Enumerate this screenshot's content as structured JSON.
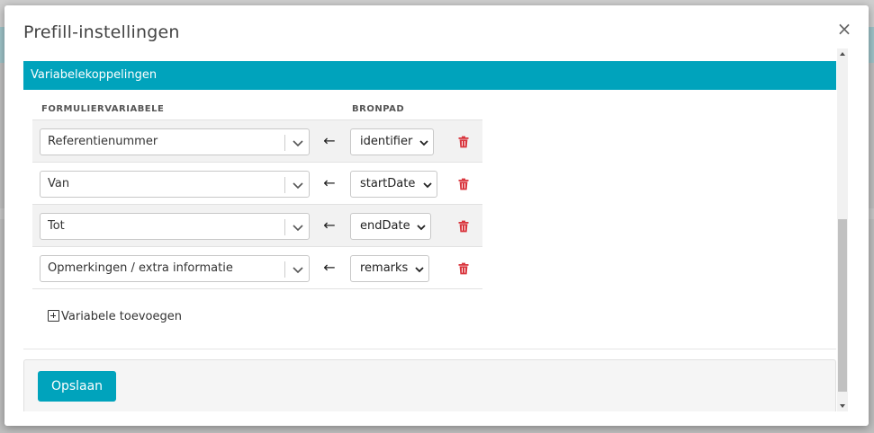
{
  "modal": {
    "title": "Prefill-instellingen",
    "close_glyph": "×"
  },
  "section": {
    "header": "Variabelekoppelingen"
  },
  "table": {
    "col_form_var": "FORMULIERVARIABELE",
    "col_source_path": "BRONPAD",
    "arrow_glyph": "←",
    "rows": [
      {
        "form_variable": "Referentienummer",
        "source_path": "identifier"
      },
      {
        "form_variable": "Van",
        "source_path": "startDate"
      },
      {
        "form_variable": "Tot",
        "source_path": "endDate"
      },
      {
        "form_variable": "Opmerkingen / extra informatie",
        "source_path": "remarks"
      }
    ]
  },
  "add_variable_label": "Variabele toevoegen",
  "footer": {
    "save_label": "Opslaan"
  },
  "colors": {
    "accent": "#00a3bc",
    "danger": "#d9363e"
  },
  "icons": {
    "close": "close-icon",
    "chevron": "chevron-down-icon",
    "trash": "trash-icon",
    "plus": "plus-square-icon",
    "arrow": "arrow-left-icon"
  }
}
